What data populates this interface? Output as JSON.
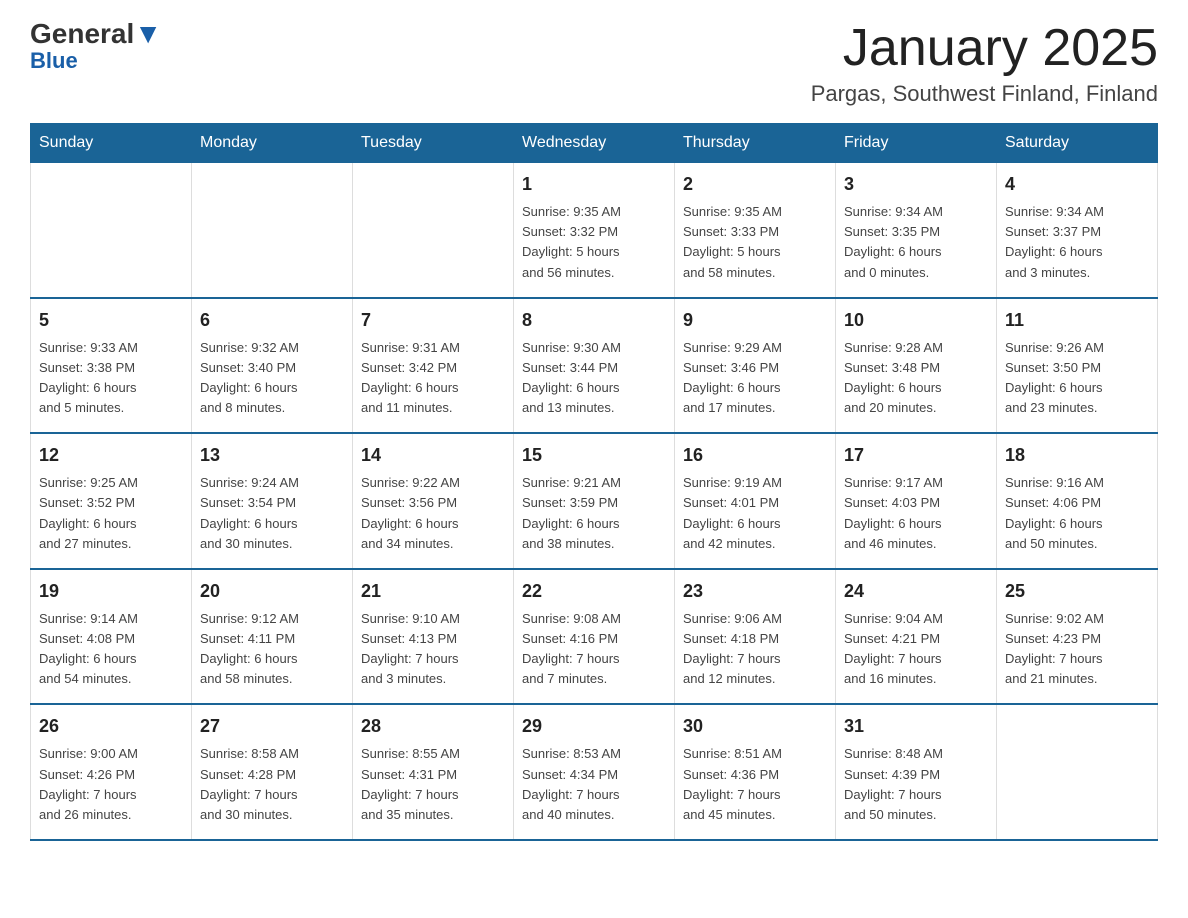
{
  "header": {
    "logo": {
      "line1_pre": "General",
      "line1_post": "",
      "line2": "Blue"
    },
    "title": "January 2025",
    "subtitle": "Pargas, Southwest Finland, Finland"
  },
  "days_of_week": [
    "Sunday",
    "Monday",
    "Tuesday",
    "Wednesday",
    "Thursday",
    "Friday",
    "Saturday"
  ],
  "weeks": [
    [
      {
        "day": "",
        "info": ""
      },
      {
        "day": "",
        "info": ""
      },
      {
        "day": "",
        "info": ""
      },
      {
        "day": "1",
        "info": "Sunrise: 9:35 AM\nSunset: 3:32 PM\nDaylight: 5 hours\nand 56 minutes."
      },
      {
        "day": "2",
        "info": "Sunrise: 9:35 AM\nSunset: 3:33 PM\nDaylight: 5 hours\nand 58 minutes."
      },
      {
        "day": "3",
        "info": "Sunrise: 9:34 AM\nSunset: 3:35 PM\nDaylight: 6 hours\nand 0 minutes."
      },
      {
        "day": "4",
        "info": "Sunrise: 9:34 AM\nSunset: 3:37 PM\nDaylight: 6 hours\nand 3 minutes."
      }
    ],
    [
      {
        "day": "5",
        "info": "Sunrise: 9:33 AM\nSunset: 3:38 PM\nDaylight: 6 hours\nand 5 minutes."
      },
      {
        "day": "6",
        "info": "Sunrise: 9:32 AM\nSunset: 3:40 PM\nDaylight: 6 hours\nand 8 minutes."
      },
      {
        "day": "7",
        "info": "Sunrise: 9:31 AM\nSunset: 3:42 PM\nDaylight: 6 hours\nand 11 minutes."
      },
      {
        "day": "8",
        "info": "Sunrise: 9:30 AM\nSunset: 3:44 PM\nDaylight: 6 hours\nand 13 minutes."
      },
      {
        "day": "9",
        "info": "Sunrise: 9:29 AM\nSunset: 3:46 PM\nDaylight: 6 hours\nand 17 minutes."
      },
      {
        "day": "10",
        "info": "Sunrise: 9:28 AM\nSunset: 3:48 PM\nDaylight: 6 hours\nand 20 minutes."
      },
      {
        "day": "11",
        "info": "Sunrise: 9:26 AM\nSunset: 3:50 PM\nDaylight: 6 hours\nand 23 minutes."
      }
    ],
    [
      {
        "day": "12",
        "info": "Sunrise: 9:25 AM\nSunset: 3:52 PM\nDaylight: 6 hours\nand 27 minutes."
      },
      {
        "day": "13",
        "info": "Sunrise: 9:24 AM\nSunset: 3:54 PM\nDaylight: 6 hours\nand 30 minutes."
      },
      {
        "day": "14",
        "info": "Sunrise: 9:22 AM\nSunset: 3:56 PM\nDaylight: 6 hours\nand 34 minutes."
      },
      {
        "day": "15",
        "info": "Sunrise: 9:21 AM\nSunset: 3:59 PM\nDaylight: 6 hours\nand 38 minutes."
      },
      {
        "day": "16",
        "info": "Sunrise: 9:19 AM\nSunset: 4:01 PM\nDaylight: 6 hours\nand 42 minutes."
      },
      {
        "day": "17",
        "info": "Sunrise: 9:17 AM\nSunset: 4:03 PM\nDaylight: 6 hours\nand 46 minutes."
      },
      {
        "day": "18",
        "info": "Sunrise: 9:16 AM\nSunset: 4:06 PM\nDaylight: 6 hours\nand 50 minutes."
      }
    ],
    [
      {
        "day": "19",
        "info": "Sunrise: 9:14 AM\nSunset: 4:08 PM\nDaylight: 6 hours\nand 54 minutes."
      },
      {
        "day": "20",
        "info": "Sunrise: 9:12 AM\nSunset: 4:11 PM\nDaylight: 6 hours\nand 58 minutes."
      },
      {
        "day": "21",
        "info": "Sunrise: 9:10 AM\nSunset: 4:13 PM\nDaylight: 7 hours\nand 3 minutes."
      },
      {
        "day": "22",
        "info": "Sunrise: 9:08 AM\nSunset: 4:16 PM\nDaylight: 7 hours\nand 7 minutes."
      },
      {
        "day": "23",
        "info": "Sunrise: 9:06 AM\nSunset: 4:18 PM\nDaylight: 7 hours\nand 12 minutes."
      },
      {
        "day": "24",
        "info": "Sunrise: 9:04 AM\nSunset: 4:21 PM\nDaylight: 7 hours\nand 16 minutes."
      },
      {
        "day": "25",
        "info": "Sunrise: 9:02 AM\nSunset: 4:23 PM\nDaylight: 7 hours\nand 21 minutes."
      }
    ],
    [
      {
        "day": "26",
        "info": "Sunrise: 9:00 AM\nSunset: 4:26 PM\nDaylight: 7 hours\nand 26 minutes."
      },
      {
        "day": "27",
        "info": "Sunrise: 8:58 AM\nSunset: 4:28 PM\nDaylight: 7 hours\nand 30 minutes."
      },
      {
        "day": "28",
        "info": "Sunrise: 8:55 AM\nSunset: 4:31 PM\nDaylight: 7 hours\nand 35 minutes."
      },
      {
        "day": "29",
        "info": "Sunrise: 8:53 AM\nSunset: 4:34 PM\nDaylight: 7 hours\nand 40 minutes."
      },
      {
        "day": "30",
        "info": "Sunrise: 8:51 AM\nSunset: 4:36 PM\nDaylight: 7 hours\nand 45 minutes."
      },
      {
        "day": "31",
        "info": "Sunrise: 8:48 AM\nSunset: 4:39 PM\nDaylight: 7 hours\nand 50 minutes."
      },
      {
        "day": "",
        "info": ""
      }
    ]
  ]
}
